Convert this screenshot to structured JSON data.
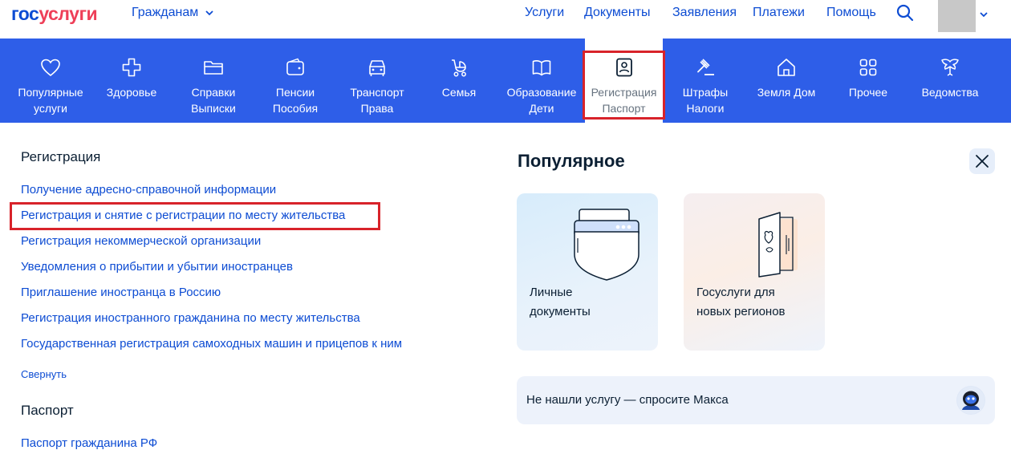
{
  "header": {
    "logo_part1": "гос",
    "logo_part2": "услуги",
    "audience_label": "Гражданам",
    "nav": [
      "Услуги",
      "Документы",
      "Заявления",
      "Платежи",
      "Помощь"
    ]
  },
  "categories": [
    {
      "label": "Популярные\nуслуги",
      "icon": "heart-icon"
    },
    {
      "label": "Здоровье",
      "icon": "medical-cross-icon"
    },
    {
      "label": "Справки\nВыписки",
      "icon": "folder-icon"
    },
    {
      "label": "Пенсии\nПособия",
      "icon": "wallet-icon"
    },
    {
      "label": "Транспорт\nПрава",
      "icon": "car-icon"
    },
    {
      "label": "Семья",
      "icon": "stroller-icon"
    },
    {
      "label": "Образование\nДети",
      "icon": "book-icon"
    },
    {
      "label": "Регистрация\nПаспорт",
      "icon": "id-card-icon"
    },
    {
      "label": "Штрафы\nНалоги",
      "icon": "gavel-icon"
    },
    {
      "label": "Земля Дом",
      "icon": "house-icon"
    },
    {
      "label": "Прочее",
      "icon": "grid-icon"
    },
    {
      "label": "Ведомства",
      "icon": "eagle-icon"
    }
  ],
  "registration": {
    "title": "Регистрация",
    "links": [
      "Получение адресно-справочной информации",
      "Регистрация и снятие с регистрации по месту жительства",
      "Регистрация некоммерческой организации",
      "Уведомления о прибытии и убытии иностранцев",
      "Приглашение иностранца в Россию",
      "Регистрация иностранного гражданина по месту жительства",
      "Государственная регистрация самоходных машин и прицепов к ним"
    ],
    "collapse_label": "Свернуть"
  },
  "passport": {
    "title": "Паспорт",
    "links": [
      "Паспорт гражданина РФ"
    ]
  },
  "popular": {
    "title": "Популярное",
    "cards": [
      {
        "label": "Личные\nдокументы"
      },
      {
        "label": "Госуслуги для\nновых регионов"
      }
    ],
    "ask_text": "Не нашли услугу — спросите Макса"
  },
  "colors": {
    "brand_blue": "#0d4cd3",
    "brand_red": "#ee3f58",
    "band_blue": "#2e5ee8",
    "highlight_red": "#d8232a"
  }
}
